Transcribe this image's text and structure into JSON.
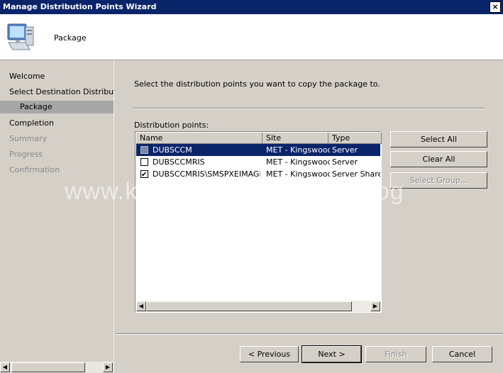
{
  "window": {
    "title": "Manage Distribution Points Wizard",
    "close_glyph": "×"
  },
  "header": {
    "title": "Package",
    "icon": "computer-icon"
  },
  "sidebar": {
    "items": [
      {
        "label": "Welcome",
        "state": "normal"
      },
      {
        "label": "Select Destination Distribution Point",
        "state": "normal"
      },
      {
        "label": "Package",
        "state": "selected"
      },
      {
        "label": "Completion",
        "state": "normal"
      },
      {
        "label": "Summary",
        "state": "dim"
      },
      {
        "label": "Progress",
        "state": "dim"
      },
      {
        "label": "Confirmation",
        "state": "dim"
      }
    ]
  },
  "main": {
    "instruction": "Select the distribution points you want to copy the package to.",
    "list_label": "Distribution points:",
    "columns": [
      "Name",
      "Site",
      "Type"
    ],
    "rows": [
      {
        "name": "DUBSCCM",
        "site": "MET - Kingswood",
        "type": "Server",
        "checked": "indeterminate",
        "selected": true
      },
      {
        "name": "DUBSCCMRIS",
        "site": "MET - Kingswood",
        "type": "Server",
        "checked": "unchecked",
        "selected": false
      },
      {
        "name": "DUBSCCMRIS\\SMSPXEIMAGES$",
        "site": "MET - Kingswood",
        "type": "Server Share",
        "checked": "checked",
        "selected": false
      }
    ],
    "buttons": {
      "select_all": "Select All",
      "clear_all": "Clear All",
      "select_group": "Select Group..."
    }
  },
  "footer": {
    "previous": "< Previous",
    "next": "Next >",
    "finish": "Finish",
    "cancel": "Cancel"
  },
  "watermark": "www.kozeniauskas.com/itblog",
  "colors": {
    "title_bar": "#0a246a",
    "selection": "#0a246a",
    "face": "#d4d0c8",
    "sidebar_selected": "#a6a6a6"
  }
}
